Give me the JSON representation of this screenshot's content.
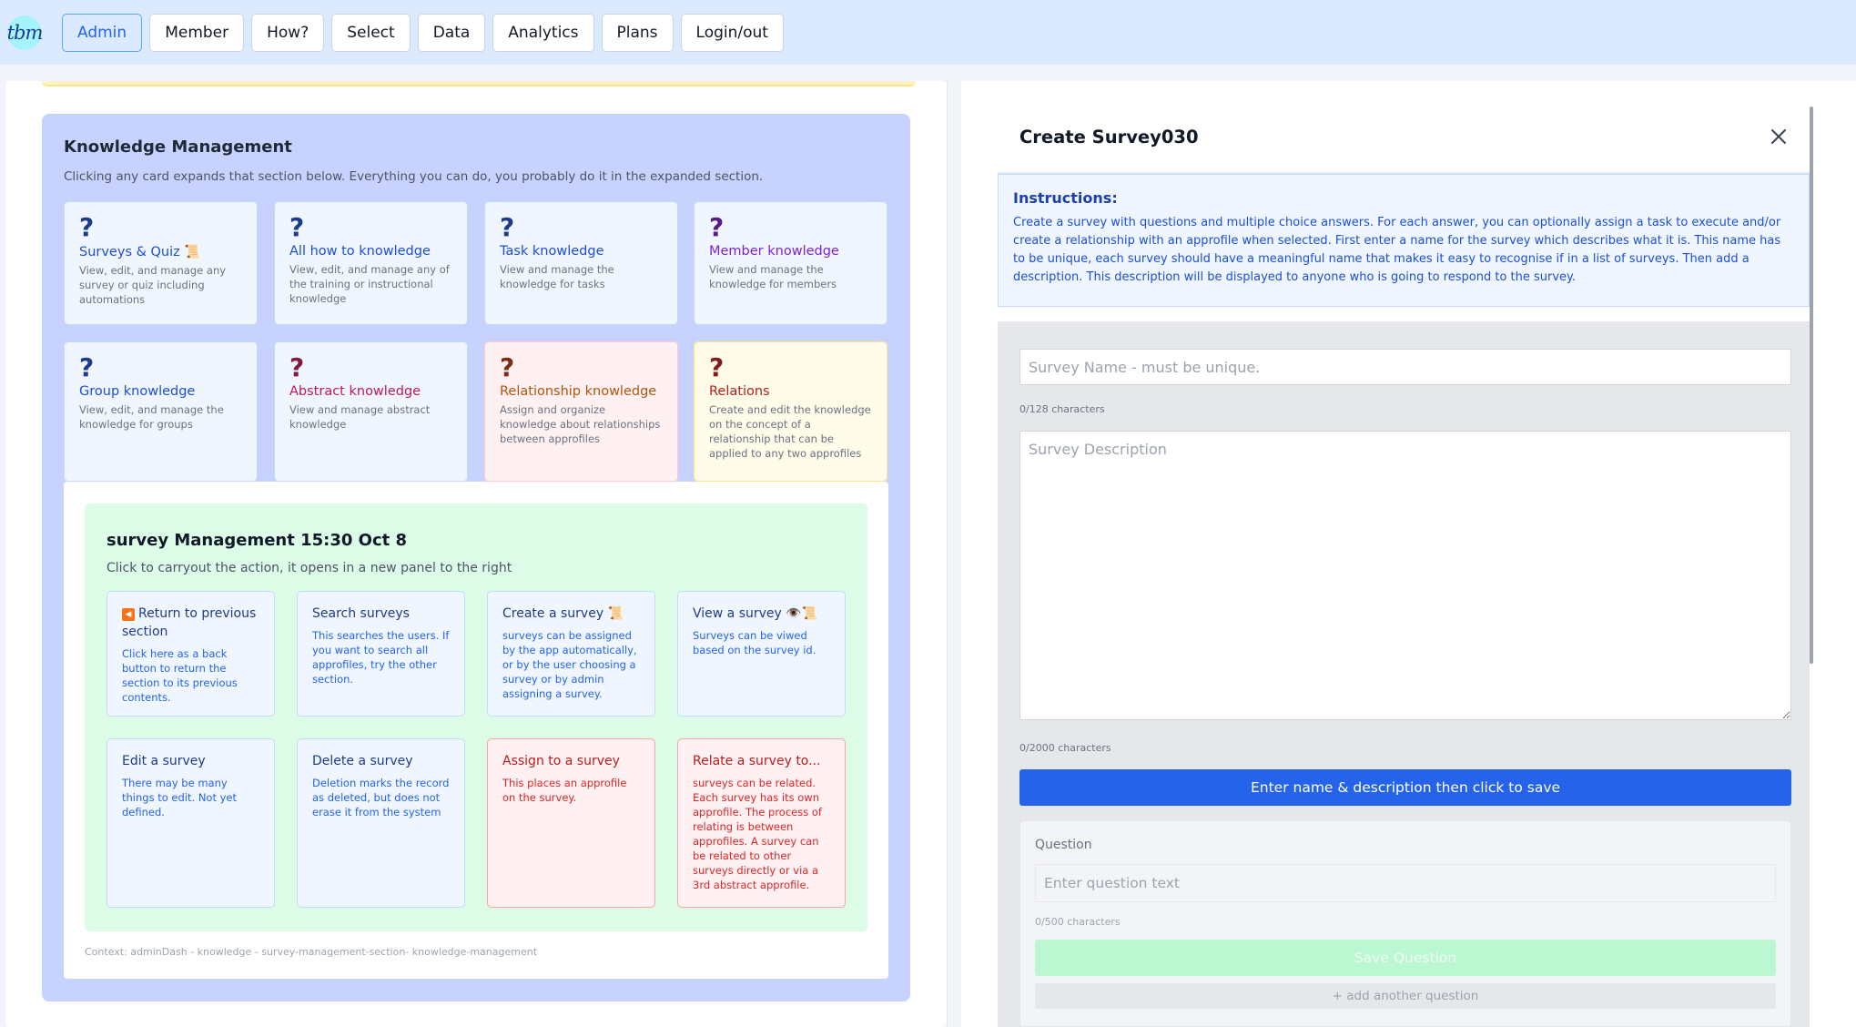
{
  "nav": {
    "logo_text": "tbm",
    "items": [
      {
        "label": "Admin",
        "active": true
      },
      {
        "label": "Member"
      },
      {
        "label": "How?"
      },
      {
        "label": "Select"
      },
      {
        "label": "Data"
      },
      {
        "label": "Analytics"
      },
      {
        "label": "Plans"
      },
      {
        "label": "Login/out"
      }
    ]
  },
  "knowledge": {
    "title": "Knowledge Management",
    "subtitle": "Clicking any card expands that section below. Everything you can do, you probably do it in the expanded section.",
    "cards": [
      {
        "icon": "?",
        "title": "Surveys & Quiz 📜",
        "desc": "View, edit, and manage any survey or quiz including automations"
      },
      {
        "icon": "?",
        "title": "All how to knowledge",
        "desc": "View, edit, and manage any of the training or instructional knowledge"
      },
      {
        "icon": "?",
        "title": "Task knowledge",
        "desc": "View and manage the knowledge for tasks"
      },
      {
        "icon": "?",
        "title": "Member knowledge",
        "desc": "View and manage the knowledge for members"
      },
      {
        "icon": "?",
        "title": "Group knowledge",
        "desc": "View, edit, and manage the knowledge for groups"
      },
      {
        "icon": "?",
        "title": "Abstract knowledge",
        "desc": "View and manage abstract knowledge"
      },
      {
        "icon": "?",
        "title": "Relationship knowledge",
        "desc": "Assign and organize knowledge about relationships between approfiles"
      },
      {
        "icon": "?",
        "title": "Relations",
        "desc": "Create and edit the knowledge on the concept of a relationship that can be applied to any two approfiles"
      }
    ]
  },
  "survey_mgmt": {
    "title": "survey Management 15:30 Oct 8",
    "subtitle": "Click to carryout the action, it opens in a new panel to the right",
    "actions": [
      {
        "icon": "◀",
        "title": "Return to previous section",
        "desc": "Click here as a back button to return the section to its previous contents."
      },
      {
        "title": "Search surveys",
        "desc": "This searches the users. If you want to search all approfiles, try the other section."
      },
      {
        "title": "Create a survey 📜",
        "desc": "surveys can be assigned by the app automatically, or by the user choosing a survey or by admin assigning a survey."
      },
      {
        "title": "View a survey 👁️📜",
        "desc": "Surveys can be viwed based on the survey id."
      },
      {
        "title": "Edit a survey",
        "desc": "There may be many things to edit. Not yet defined."
      },
      {
        "title": "Delete a survey",
        "desc": "Deletion marks the record as deleted, but does not erase it from the system"
      },
      {
        "title": "Assign to a survey",
        "desc": "This places an approfile on the survey."
      },
      {
        "title": "Relate a survey to...",
        "desc": "surveys can be related. Each survey has its own approfile. The process of relating is between approfiles. A survey can be related to other surveys directly or via a 3rd abstract approfile."
      }
    ],
    "context": "Context: adminDash - knowledge - survey-management-section- knowledge-management"
  },
  "create_panel": {
    "title": "Create Survey030",
    "instructions_title": "Instructions:",
    "instructions_text": "Create a survey with questions and multiple choice answers. For each answer, you can optionally assign a task to execute and/or create a relationship with an approfile when selected. First enter a name for the survey which describes what it is. This name has to be unique, each survey should have a meaningful name that makes it easy to recognise if in a list of surveys. Then add a description. This description will be displayed to anyone who is going to respond to the survey.",
    "name_placeholder": "Survey Name - must be unique.",
    "name_count": "0/128 characters",
    "desc_placeholder": "Survey Description",
    "desc_count": "0/2000 characters",
    "save_label": "Enter name & description then click to save",
    "question_label": "Question",
    "question_placeholder": "Enter question text",
    "question_count": "0/500 characters",
    "save_question_label": "Save Question",
    "add_question_label": "+ add another question"
  }
}
